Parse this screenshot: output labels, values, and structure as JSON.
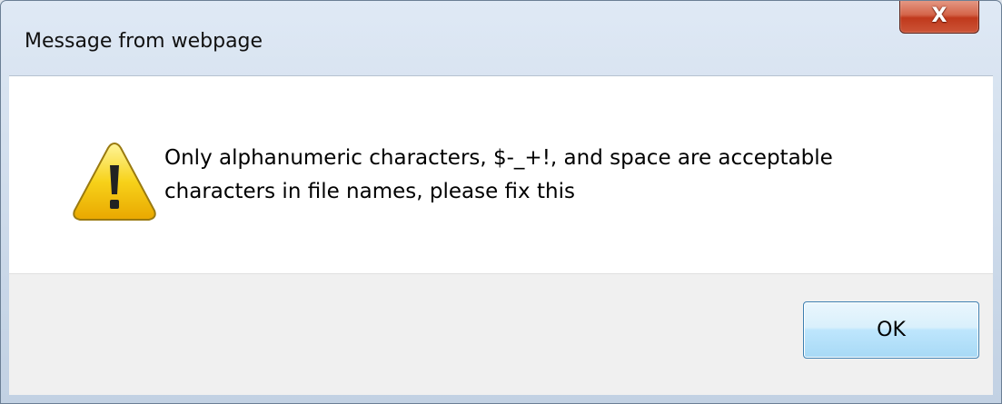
{
  "window": {
    "title": "Message from webpage",
    "close_glyph": "X"
  },
  "message": {
    "line1": "Only alphanumeric characters, $-_+!, and space are acceptable",
    "line2": "characters in file names, please fix this",
    "icon": "warning-icon"
  },
  "buttons": {
    "ok_label": "OK"
  },
  "colors": {
    "close_button": "#c7452a",
    "ok_button_border": "#3c7fb1",
    "warning_fill": "#f5c400"
  }
}
